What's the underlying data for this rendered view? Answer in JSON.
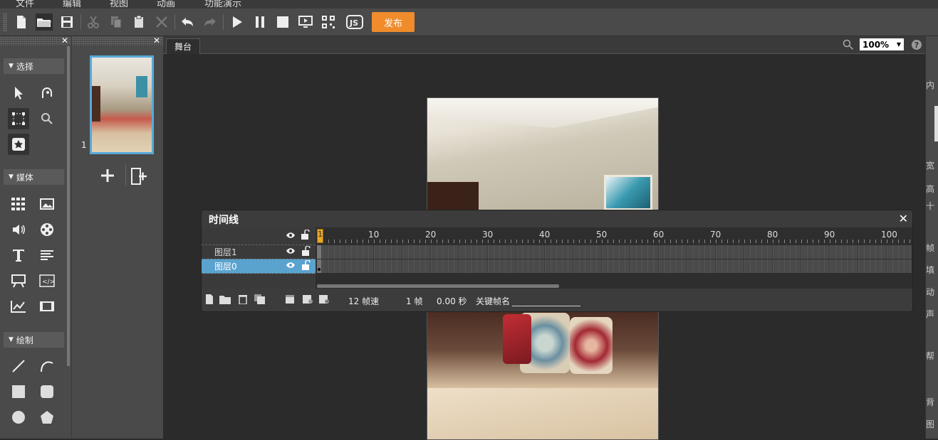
{
  "menu": [
    "文件",
    "编辑",
    "视图",
    "动画",
    "功能演示"
  ],
  "toolbar": {
    "publish_label": "发布",
    "icons": [
      "new-file-icon",
      "open-folder-icon",
      "save-icon",
      "cut-icon",
      "copy-icon",
      "paste-icon",
      "delete-icon",
      "undo-icon",
      "redo-icon",
      "play-icon",
      "pause-icon",
      "stop-icon",
      "preview-icon",
      "qrcode-icon",
      "js-icon"
    ]
  },
  "left_panel": {
    "sections": [
      {
        "label": "选择",
        "tools": [
          "select-arrow-icon",
          "lasso-icon",
          "transform-icon",
          "zoom-icon",
          "symbol-icon"
        ]
      },
      {
        "label": "媒体",
        "tools": [
          "grid-icon",
          "image-icon",
          "audio-icon",
          "video-icon",
          "text-icon",
          "paragraph-icon",
          "board-icon",
          "code-icon",
          "chart-icon",
          "film-icon"
        ]
      },
      {
        "label": "绘制",
        "tools": [
          "line-icon",
          "curve-icon",
          "rect-icon",
          "rounded-rect-icon",
          "circle-icon",
          "polygon-icon"
        ]
      }
    ]
  },
  "pages": {
    "items": [
      {
        "number": "1"
      }
    ]
  },
  "stage": {
    "tab_label": "舞台",
    "zoom_value": "100%",
    "help_label": "?"
  },
  "timeline": {
    "title": "时间线",
    "ruler_numbers": [
      "1",
      "10",
      "20",
      "30",
      "40",
      "50",
      "60",
      "70",
      "80",
      "90",
      "100"
    ],
    "layers": [
      {
        "name": "图层1",
        "selected": false
      },
      {
        "name": "图层0",
        "selected": true
      }
    ],
    "fps_text": "12 帧速",
    "frame_text": "1 帧",
    "time_text": "0.00 秒",
    "keyframe_label": "关键帧名"
  },
  "right_panel_fragments": [
    "内",
    "宽",
    "高",
    "十",
    "帧",
    "填",
    "动",
    "声",
    "帮",
    "背",
    "图"
  ],
  "colors": {
    "accent": "#f08c2c",
    "selection": "#5aa3cf",
    "panel": "#4a4a4a"
  }
}
